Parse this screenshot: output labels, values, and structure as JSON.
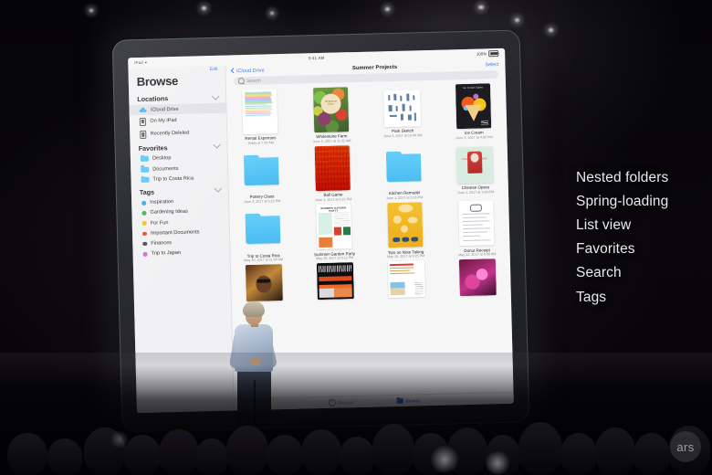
{
  "scene": {
    "venue": "keynote-stage",
    "watermark": "ars"
  },
  "ipad": {
    "status_bar": {
      "device_label": "iPad",
      "wifi_icon": "wifi-icon",
      "time": "9:41 AM",
      "battery_percent": "100%"
    },
    "sidebar": {
      "edit_label": "Edit",
      "title": "Browse",
      "sections": [
        {
          "header": "Locations",
          "items": [
            {
              "label": "iCloud Drive",
              "icon": "cloud-icon",
              "selected": true
            },
            {
              "label": "On My iPad",
              "icon": "ipad-icon",
              "selected": false
            },
            {
              "label": "Recently Deleted",
              "icon": "ipad-icon",
              "selected": false
            }
          ]
        },
        {
          "header": "Favorites",
          "items": [
            {
              "label": "Desktop",
              "icon": "folder-icon",
              "color": "#5ac8f5"
            },
            {
              "label": "Documents",
              "icon": "folder-icon",
              "color": "#5ac8f5"
            },
            {
              "label": "Trip to Costa Rica",
              "icon": "folder-icon",
              "color": "#5ac8f5"
            }
          ]
        },
        {
          "header": "Tags",
          "items": [
            {
              "label": "Inspiration",
              "icon": "tag-dot-icon",
              "color": "#3aa9e8"
            },
            {
              "label": "Gardening Ideas",
              "icon": "tag-dot-icon",
              "color": "#3fb950"
            },
            {
              "label": "For Fun",
              "icon": "tag-dot-icon",
              "color": "#f0c419"
            },
            {
              "label": "Important Documents",
              "icon": "tag-dot-icon",
              "color": "#e4502a"
            },
            {
              "label": "Finances",
              "icon": "tag-dot-icon",
              "color": "#4a4a52"
            },
            {
              "label": "Trip to Japan",
              "icon": "tag-dot-icon",
              "color": "#d96ad0"
            }
          ]
        }
      ]
    },
    "nav": {
      "back_label": "iCloud Drive",
      "back_icon": "chevron-left-icon",
      "title": "Summer Projects",
      "select_label": "Select"
    },
    "search": {
      "placeholder": "Search",
      "icon": "search-icon"
    },
    "files": {
      "rows": [
        [
          {
            "name": "Rental Expenses",
            "date": "Today at 7:05 AM",
            "kind": "spreadsheet"
          },
          {
            "name": "Whitestone Farm",
            "date": "June 3, 2017 at 11:02 AM",
            "kind": "photo-veg"
          },
          {
            "name": "Park Sketch",
            "date": "June 3, 2017 at 10:46 AM",
            "kind": "sketch"
          },
          {
            "name": "Ice Cream",
            "date": "June 3, 2017 at 4:05 PM",
            "kind": "poster-icecream"
          }
        ],
        [
          {
            "name": "Pottery Class",
            "date": "June 3, 2017 at 3:15 PM",
            "kind": "folder"
          },
          {
            "name": "Ball Game",
            "date": "June 1, 2017 at 5:22 PM",
            "kind": "photo-seats"
          },
          {
            "name": "Kitchen Remodel",
            "date": "June 1, 2017 at 3:16 PM",
            "kind": "folder"
          },
          {
            "name": "Chinese Opera",
            "date": "June 1, 2017 at 1:08 PM",
            "kind": "photo-opera"
          }
        ],
        [
          {
            "name": "Trip to Costa Rica",
            "date": "May 30, 2017 at 11:09 AM",
            "kind": "folder"
          },
          {
            "name": "Summer Garden Party",
            "date": "May 25, 2017 at 9:12 PM",
            "kind": "doc-party"
          },
          {
            "name": "Tips on Note Taking",
            "date": "May 25, 2017 at 8:25 PM",
            "kind": "poster-notes"
          },
          {
            "name": "Donut Receipt",
            "date": "May 22, 2017 at 9:48 AM",
            "kind": "receipt"
          }
        ],
        [
          {
            "name": "",
            "date": "",
            "kind": "photo-portrait"
          },
          {
            "name": "",
            "date": "",
            "kind": "poster-dark"
          },
          {
            "name": "",
            "date": "",
            "kind": "doc-beach"
          },
          {
            "name": "",
            "date": "",
            "kind": "photo-magenta"
          }
        ]
      ]
    },
    "tabbar": [
      {
        "label": "Recents",
        "icon": "clock-icon",
        "active": false
      },
      {
        "label": "Browse",
        "icon": "folder-icon",
        "active": true
      }
    ]
  },
  "features": {
    "items": [
      "Nested folders",
      "Spring-loading",
      "List view",
      "Favorites",
      "Search",
      "Tags"
    ]
  },
  "colors": {
    "ios_blue": "#3478f6",
    "folder_blue": "#5ac8f5",
    "sidebar_bg": "#f1f1f3",
    "content_bg": "#f6f6f7"
  }
}
